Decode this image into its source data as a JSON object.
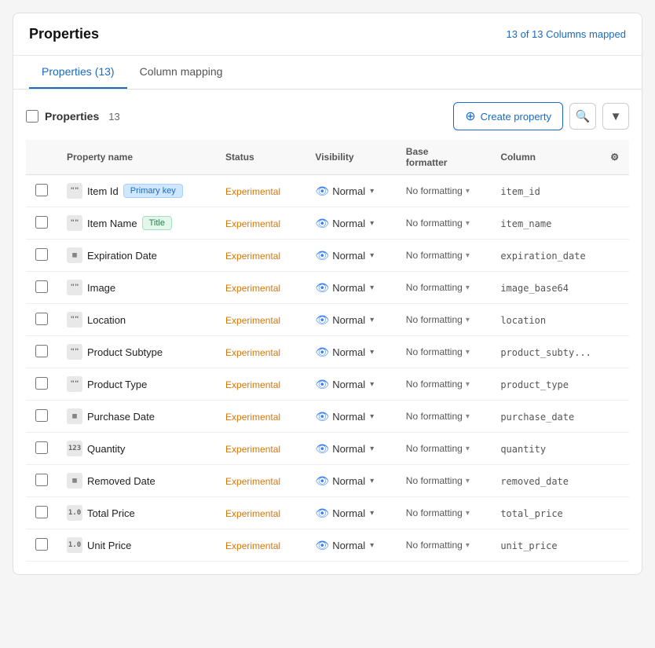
{
  "header": {
    "title": "Properties",
    "mapped_info": "13 of 13 Columns mapped"
  },
  "tabs": [
    {
      "label": "Properties (13)",
      "active": true
    },
    {
      "label": "Column mapping",
      "active": false
    }
  ],
  "toolbar": {
    "label": "Properties",
    "count": "13",
    "create_button": "Create property",
    "search_icon": "search",
    "filter_icon": "filter"
  },
  "table": {
    "columns": [
      {
        "key": "checkbox",
        "label": ""
      },
      {
        "key": "property_name",
        "label": "Property name"
      },
      {
        "key": "status",
        "label": "Status"
      },
      {
        "key": "visibility",
        "label": "Visibility"
      },
      {
        "key": "base_formatter",
        "label": "Base formatter"
      },
      {
        "key": "column",
        "label": "Column"
      },
      {
        "key": "settings",
        "label": ""
      }
    ],
    "rows": [
      {
        "id": 1,
        "type_icon": "99",
        "name": "Item Id",
        "badges": [
          "Primary key"
        ],
        "badge_types": [
          "primary"
        ],
        "status": "Experimental",
        "visibility": "Normal",
        "formatter": "No formatting",
        "column": "item_id"
      },
      {
        "id": 2,
        "type_icon": "99",
        "name": "Item Name",
        "badges": [
          "Title"
        ],
        "badge_types": [
          "title"
        ],
        "status": "Experimental",
        "visibility": "Normal",
        "formatter": "No formatting",
        "column": "item_name"
      },
      {
        "id": 3,
        "type_icon": "cal",
        "name": "Expiration Date",
        "badges": [],
        "badge_types": [],
        "status": "Experimental",
        "visibility": "Normal",
        "formatter": "No formatting",
        "column": "expiration_date"
      },
      {
        "id": 4,
        "type_icon": "99",
        "name": "Image",
        "badges": [],
        "badge_types": [],
        "status": "Experimental",
        "visibility": "Normal",
        "formatter": "No formatting",
        "column": "image_base64"
      },
      {
        "id": 5,
        "type_icon": "99",
        "name": "Location",
        "badges": [],
        "badge_types": [],
        "status": "Experimental",
        "visibility": "Normal",
        "formatter": "No formatting",
        "column": "location"
      },
      {
        "id": 6,
        "type_icon": "99",
        "name": "Product Subtype",
        "badges": [],
        "badge_types": [],
        "status": "Experimental",
        "visibility": "Normal",
        "formatter": "No formatting",
        "column": "product_subty..."
      },
      {
        "id": 7,
        "type_icon": "99",
        "name": "Product Type",
        "badges": [],
        "badge_types": [],
        "status": "Experimental",
        "visibility": "Normal",
        "formatter": "No formatting",
        "column": "product_type"
      },
      {
        "id": 8,
        "type_icon": "cal",
        "name": "Purchase Date",
        "badges": [],
        "badge_types": [],
        "status": "Experimental",
        "visibility": "Normal",
        "formatter": "No formatting",
        "column": "purchase_date"
      },
      {
        "id": 9,
        "type_icon": "123",
        "name": "Quantity",
        "badges": [],
        "badge_types": [],
        "status": "Experimental",
        "visibility": "Normal",
        "formatter": "No formatting",
        "column": "quantity"
      },
      {
        "id": 10,
        "type_icon": "cal",
        "name": "Removed Date",
        "badges": [],
        "badge_types": [],
        "status": "Experimental",
        "visibility": "Normal",
        "formatter": "No formatting",
        "column": "removed_date"
      },
      {
        "id": 11,
        "type_icon": "1.0",
        "name": "Total Price",
        "badges": [],
        "badge_types": [],
        "status": "Experimental",
        "visibility": "Normal",
        "formatter": "No formatting",
        "column": "total_price"
      },
      {
        "id": 12,
        "type_icon": "1.0",
        "name": "Unit Price",
        "badges": [],
        "badge_types": [],
        "status": "Experimental",
        "visibility": "Normal",
        "formatter": "No formatting",
        "column": "unit_price"
      }
    ]
  }
}
